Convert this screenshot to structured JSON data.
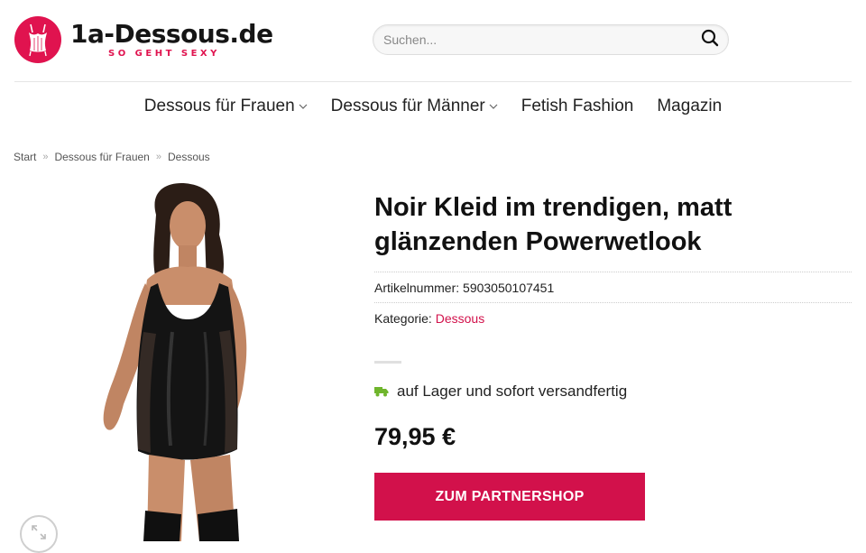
{
  "header": {
    "logo_name": "1a-Dessous.de",
    "logo_tagline": "SO GEHT SEXY",
    "search_placeholder": "Suchen..."
  },
  "nav": {
    "items": [
      {
        "label": "Dessous für Frauen",
        "has_dropdown": true
      },
      {
        "label": "Dessous für Männer",
        "has_dropdown": true
      },
      {
        "label": "Fetish Fashion",
        "has_dropdown": false
      },
      {
        "label": "Magazin",
        "has_dropdown": false
      }
    ]
  },
  "breadcrumb": {
    "items": [
      "Start",
      "Dessous für Frauen",
      "Dessous"
    ],
    "separator": "»"
  },
  "product": {
    "title": "Noir Kleid im trendigen, matt glänzenden Powerwetlook",
    "sku_label": "Artikelnummer:",
    "sku_value": "5903050107451",
    "category_label": "Kategorie:",
    "category_value": "Dessous",
    "stock_text": "auf Lager und sofort versandfertig",
    "price": "79,95 €",
    "cta_label": "ZUM PARTNERSHOP"
  },
  "colors": {
    "brand": "#e0134f",
    "cta": "#d2114b",
    "stock_icon": "#6fb52c"
  },
  "icons": {
    "logo": "corset-icon",
    "search": "search-icon",
    "stock": "truck-icon",
    "zoom": "expand-icon",
    "dropdown": "chevron-down-icon"
  }
}
